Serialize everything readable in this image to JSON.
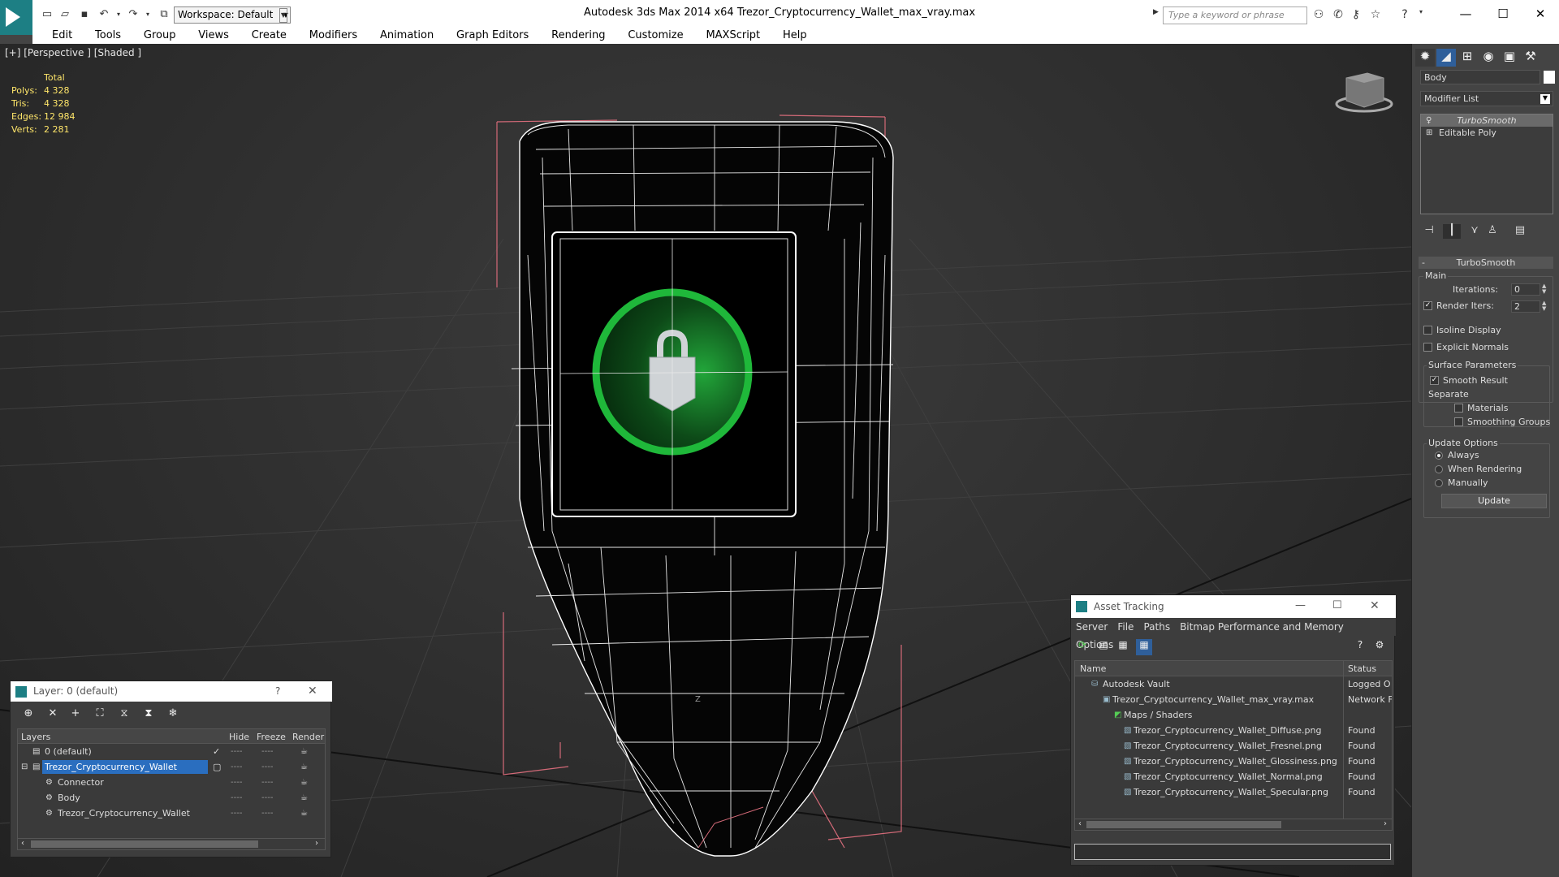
{
  "titlebar": {
    "workspace": "Workspace: Default",
    "title": "Autodesk 3ds Max  2014 x64     Trezor_Cryptocurrency_Wallet_max_vray.max",
    "search_placeholder": "Type a keyword or phrase"
  },
  "menu": [
    "Edit",
    "Tools",
    "Group",
    "Views",
    "Create",
    "Modifiers",
    "Animation",
    "Graph Editors",
    "Rendering",
    "Customize",
    "MAXScript",
    "Help"
  ],
  "viewport": {
    "label": "[+] [Perspective ] [Shaded ]",
    "stats": {
      "header": "Total",
      "rows": [
        {
          "label": "Polys:",
          "value": "4 328"
        },
        {
          "label": "Tris:",
          "value": "4 328"
        },
        {
          "label": "Edges:",
          "value": "12 984"
        },
        {
          "label": "Verts:",
          "value": "2 281"
        }
      ]
    },
    "axis_label": "Z"
  },
  "command_panel": {
    "object_name": "Body",
    "modifier_list": "Modifier List",
    "stack": [
      "TurboSmooth",
      "Editable Poly"
    ],
    "rollout_title": "TurboSmooth",
    "main_label": "Main",
    "iterations_label": "Iterations:",
    "iterations_value": "0",
    "render_iters_label": "Render Iters:",
    "render_iters_value": "2",
    "isoline_label": "Isoline Display",
    "explicit_normals_label": "Explicit Normals",
    "surface_params_label": "Surface Parameters",
    "smooth_result_label": "Smooth Result",
    "separate_label": "Separate",
    "materials_label": "Materials",
    "smoothing_groups_label": "Smoothing Groups",
    "update_options_label": "Update Options",
    "always_label": "Always",
    "when_rendering_label": "When Rendering",
    "manually_label": "Manually",
    "update_button": "Update"
  },
  "layer_window": {
    "title": "Layer: 0 (default)",
    "help": "?",
    "columns": {
      "layers": "Layers",
      "hide": "Hide",
      "freeze": "Freeze",
      "render": "Render"
    },
    "rows": [
      {
        "name": "0 (default)"
      },
      {
        "name": "Trezor_Cryptocurrency_Wallet"
      },
      {
        "name": "Connector"
      },
      {
        "name": "Body"
      },
      {
        "name": "Trezor_Cryptocurrency_Wallet"
      }
    ],
    "dash": "----"
  },
  "asset_tracking": {
    "title": "Asset Tracking",
    "menu": [
      "Server",
      "File",
      "Paths",
      "Bitmap Performance and Memory",
      "Options"
    ],
    "columns": {
      "name": "Name",
      "status": "Status"
    },
    "rows": [
      {
        "name": "Autodesk Vault",
        "status": "Logged O"
      },
      {
        "name": "Trezor_Cryptocurrency_Wallet_max_vray.max",
        "status": "Network F"
      },
      {
        "name": "Maps / Shaders",
        "status": ""
      },
      {
        "name": "Trezor_Cryptocurrency_Wallet_Diffuse.png",
        "status": "Found"
      },
      {
        "name": "Trezor_Cryptocurrency_Wallet_Fresnel.png",
        "status": "Found"
      },
      {
        "name": "Trezor_Cryptocurrency_Wallet_Glossiness.png",
        "status": "Found"
      },
      {
        "name": "Trezor_Cryptocurrency_Wallet_Normal.png",
        "status": "Found"
      },
      {
        "name": "Trezor_Cryptocurrency_Wallet_Specular.png",
        "status": "Found"
      }
    ]
  },
  "colors": {
    "app_accent": "#1d7f84",
    "stats_text": "#ffe66a",
    "selection": "#2a6ebf",
    "lock_ring": "#1fb83a",
    "viewport_bg": "#2e2e2e"
  }
}
